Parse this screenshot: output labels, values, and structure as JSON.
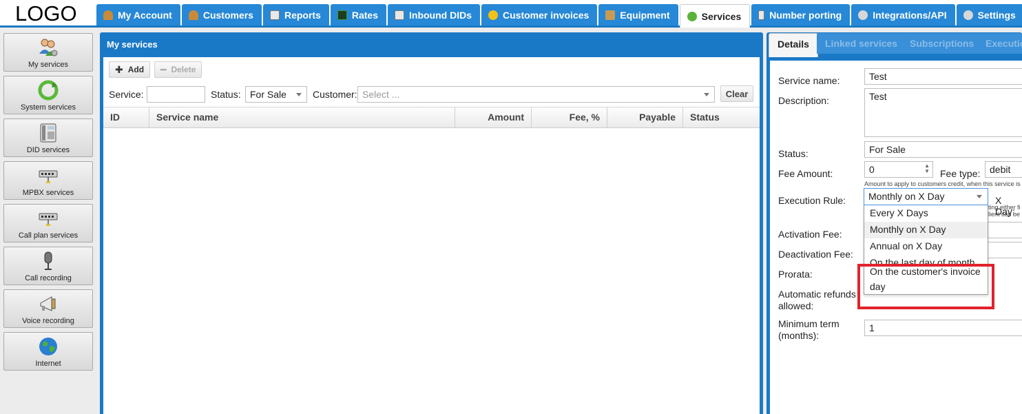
{
  "app": {
    "logo": "LOGO"
  },
  "nav": {
    "tabs": [
      {
        "label": "My Account",
        "icon": "user-icon",
        "color": "#c98b3a"
      },
      {
        "label": "Customers",
        "icon": "customer-icon",
        "color": "#c98b3a"
      },
      {
        "label": "Reports",
        "icon": "report-icon",
        "color": "#d7d7d7"
      },
      {
        "label": "Rates",
        "icon": "rates-icon",
        "color": "#3a9b3a"
      },
      {
        "label": "Inbound DIDs",
        "icon": "did-icon",
        "color": "#d7d7d7"
      },
      {
        "label": "Customer invoices",
        "icon": "coins-icon",
        "color": "#f2c21b"
      },
      {
        "label": "Equipment",
        "icon": "box-icon",
        "color": "#c99b52"
      },
      {
        "label": "Services",
        "icon": "refresh-icon",
        "color": "#59b33a",
        "active": true
      },
      {
        "label": "Number porting",
        "icon": "phone-icon",
        "color": "#d7d7d7"
      },
      {
        "label": "Integrations/API",
        "icon": "gear-icon",
        "color": "#d7d7d7"
      },
      {
        "label": "Settings",
        "icon": "settings-icon",
        "color": "#d7d7d7"
      }
    ]
  },
  "sidebar": {
    "items": [
      {
        "label": "My services",
        "icon": "users-gear-icon"
      },
      {
        "label": "System services",
        "icon": "refresh-icon"
      },
      {
        "label": "DID services",
        "icon": "desk-phone-icon"
      },
      {
        "label": "MPBX services",
        "icon": "network-switch-icon"
      },
      {
        "label": "Call plan services",
        "icon": "network-switch-icon"
      },
      {
        "label": "Call recording",
        "icon": "microphone-icon"
      },
      {
        "label": "Voice recording",
        "icon": "megaphone-icon"
      },
      {
        "label": "Internet",
        "icon": "globe-icon"
      }
    ]
  },
  "main": {
    "title": "My services",
    "add_label": "Add",
    "delete_label": "Delete",
    "filters": {
      "service_label": "Service:",
      "service_value": "",
      "status_label": "Status:",
      "status_value": "For Sale",
      "customer_label": "Customer:",
      "customer_placeholder": "Select ...",
      "clear_label": "Clear"
    },
    "columns": [
      "ID",
      "Service name",
      "Amount",
      "Fee, %",
      "Payable",
      "Status"
    ]
  },
  "details": {
    "tabs": [
      "Details",
      "Linked services",
      "Subscriptions",
      "Executio"
    ],
    "service_name_label": "Service name:",
    "service_name_value": "Test",
    "description_label": "Description:",
    "description_value": "Test",
    "status_label": "Status:",
    "status_value": "For Sale",
    "fee_amount_label": "Fee Amount:",
    "fee_amount_value": "0",
    "fee_type_label": "Fee type:",
    "fee_type_value": "debit",
    "fee_hint": "Amount to apply to customers credit, when this service is",
    "execution_rule_label": "Execution Rule:",
    "execution_rule_value": "Monthly on X Day",
    "x_day_label": "X Day:",
    "exec_hint_1": "ting either fi",
    "exec_hint_2": "lient can be",
    "activation_fee_label": "Activation Fee:",
    "deactivation_fee_label": "Deactivation Fee:",
    "prorata_label": "Prorata:",
    "refunds_label_1": "Automatic refunds",
    "refunds_label_2": "allowed:",
    "min_term_label_1": "Minimum term",
    "min_term_label_2": "(months):",
    "min_term_value": "1",
    "execution_options": [
      "Every X Days",
      "Monthly on X Day",
      "Annual on X Day",
      "On the last day of month",
      "On the customer's invoice day"
    ]
  }
}
